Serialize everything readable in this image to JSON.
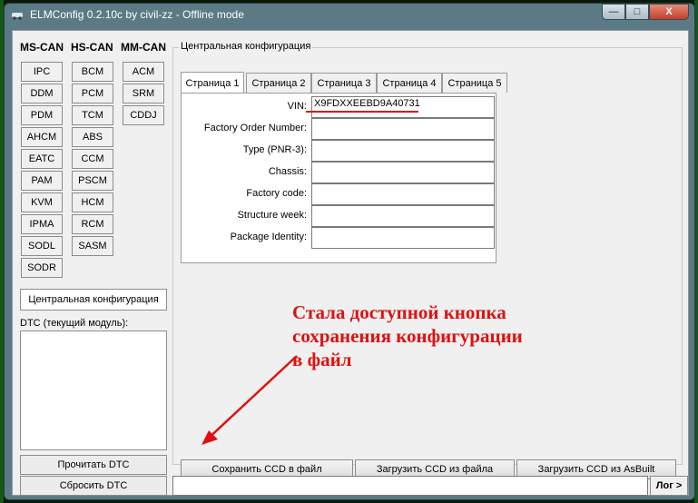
{
  "window": {
    "title": "ELMConfig 0.2.10c by civil-zz - Offline mode",
    "minimize_symbol": "—",
    "maximize_symbol": "□",
    "close_symbol": "X"
  },
  "buses": {
    "ms_can": {
      "label": "MS-CAN",
      "modules": [
        "IPC",
        "DDM",
        "PDM",
        "AHCM",
        "EATC",
        "PAM",
        "KVM",
        "IPMA",
        "SODL",
        "SODR"
      ]
    },
    "hs_can": {
      "label": "HS-CAN",
      "modules": [
        "BCM",
        "PCM",
        "TCM",
        "ABS",
        "CCM",
        "PSCM",
        "HCM",
        "RCM",
        "SASM"
      ]
    },
    "mm_can": {
      "label": "MM-CAN",
      "modules": [
        "ACM",
        "SRM",
        "CDDJ"
      ]
    }
  },
  "left_panel": {
    "central_config_button": "Центральная конфигурация",
    "dtc_label": "DTC (текущий модуль):",
    "read_dtc_button": "Прочитать DTC",
    "clear_dtc_button": "Сбросить DTC"
  },
  "central_config": {
    "group_title": "Центральная конфигурация",
    "tabs": [
      "Страница 1",
      "Страница 2",
      "Страница 3",
      "Страница 4",
      "Страница 5"
    ],
    "active_tab": "Страница 1",
    "fields": [
      {
        "label": "VIN:",
        "value": "X9FDXXEEBD9A40731"
      },
      {
        "label": "Factory Order Number:",
        "value": ""
      },
      {
        "label": "Type (PNR-3):",
        "value": ""
      },
      {
        "label": "Chassis:",
        "value": ""
      },
      {
        "label": "Factory code:",
        "value": ""
      },
      {
        "label": "Structure week:",
        "value": ""
      },
      {
        "label": "Package Identity:",
        "value": ""
      }
    ],
    "buttons": {
      "save_ccd": "Сохранить CCD в файл",
      "load_ccd_file": "Загрузить CCD из файла",
      "load_ccd_asbuilt": "Загрузить CCD из AsBuilt"
    }
  },
  "log": {
    "button": "Лог >",
    "value": ""
  },
  "annotation": {
    "text_lines": [
      "Стала доступной кнопка",
      "сохранения конфигурации",
      "в файл"
    ],
    "color": "#e01010"
  }
}
